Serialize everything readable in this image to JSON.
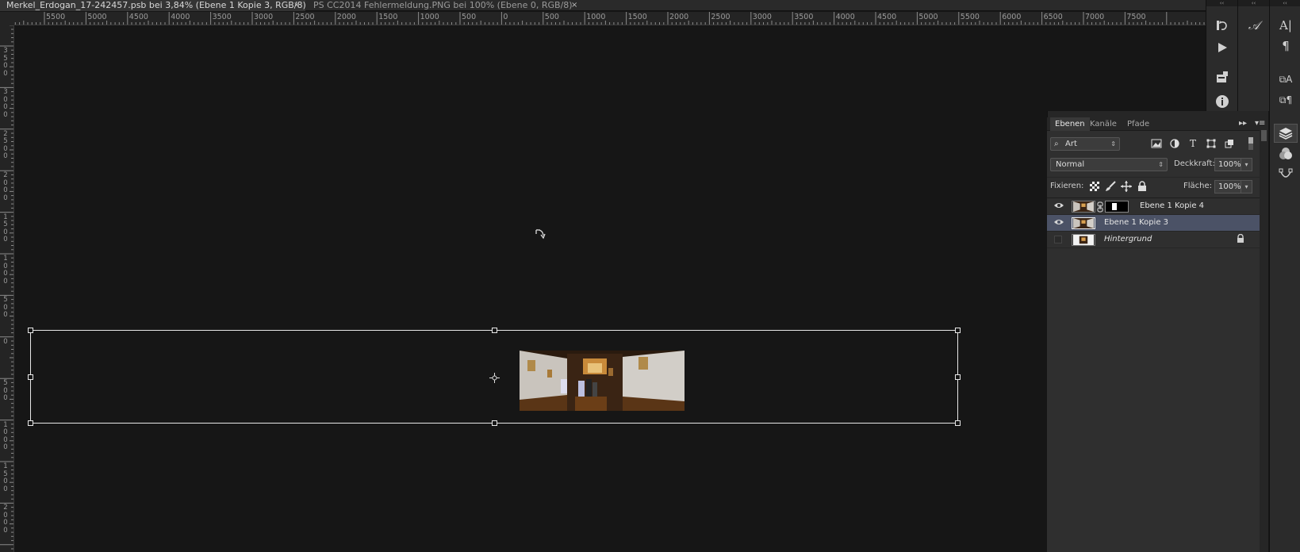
{
  "tabs": [
    {
      "title": "Merkel_Erdogan_17-242457.psb bei 3,84% (Ebene 1 Kopie 3, RGB/8) *",
      "close": "×",
      "active": true
    },
    {
      "title": "PS CC2014 Fehlermeldung.PNG bei 100% (Ebene 0, RGB/8)",
      "close": "×",
      "active": false
    }
  ],
  "rulers": {
    "horizontal_labels": [
      "5500",
      "5000",
      "4500",
      "4000",
      "3500",
      "3000",
      "2500",
      "2000",
      "1500",
      "1000",
      "500",
      "0",
      "500",
      "1000",
      "1500",
      "2000",
      "2500",
      "3000",
      "3500",
      "4000",
      "4500",
      "5000",
      "5500",
      "6000",
      "6500",
      "7000",
      "7500"
    ],
    "vertical_labels": [
      "3\n5\n0\n0",
      "3\n0\n0\n0",
      "2\n5\n0\n0",
      "2\n0\n0\n0",
      "1\n5\n0\n0",
      "1\n0\n0\n0",
      "5\n0\n0",
      "0",
      "5\n0\n0",
      "1\n0\n0\n0",
      "1\n5\n0\n0",
      "2\n0\n0\n0"
    ]
  },
  "dock": {
    "collapse_glyph": "‹‹",
    "strip1_icons": [
      "history-icon",
      "play-icon",
      "cube-info-icon",
      "info-icon"
    ],
    "strip2_icons": [
      "glyph-icon"
    ],
    "strip3_icons": [
      "character-icon",
      "paragraph-icon",
      "character-styles-icon",
      "paragraph-styles-icon",
      "layers-icon",
      "channels-icon",
      "paths-icon"
    ]
  },
  "layers_panel": {
    "tabs": [
      "Ebenen",
      "Kanäle",
      "Pfade"
    ],
    "collapse_glyph": "▸▸",
    "menu_glyph": "▾≡",
    "filter": {
      "label": "Art",
      "search_glyph": "⌕",
      "chevron": "⇕"
    },
    "blend_mode": {
      "value": "Normal",
      "chevron": "⇕"
    },
    "opacity": {
      "label": "Deckkraft:",
      "value": "100%",
      "arrow": "▾"
    },
    "lock": {
      "label": "Fixieren:"
    },
    "fill": {
      "label": "Fläche:",
      "value": "100%",
      "arrow": "▾"
    },
    "layers": [
      {
        "name": "Ebene 1 Kopie 4",
        "visible": true,
        "selected": false,
        "has_mask": true,
        "italic": false,
        "locked": false
      },
      {
        "name": "Ebene 1 Kopie 3",
        "visible": true,
        "selected": true,
        "has_mask": false,
        "italic": false,
        "locked": false
      },
      {
        "name": "Hintergrund",
        "visible": false,
        "selected": false,
        "has_mask": false,
        "italic": true,
        "locked": true
      }
    ],
    "eye_glyph": "◉",
    "link_glyph": "⛓",
    "lock_glyph": "🔒"
  }
}
